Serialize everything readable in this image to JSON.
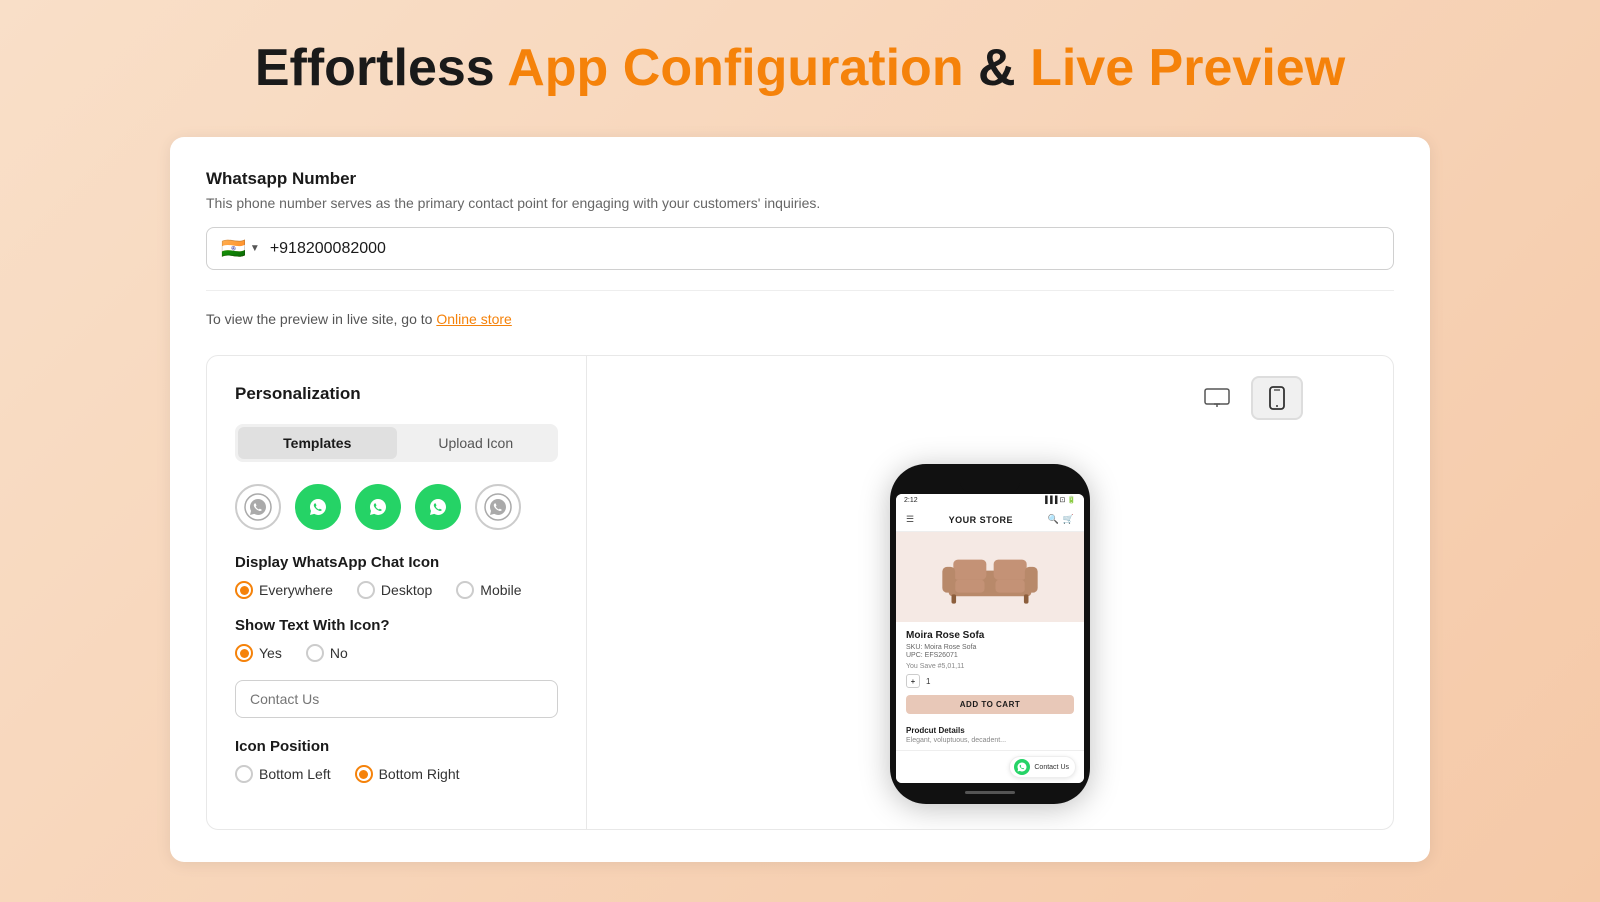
{
  "page": {
    "title_black1": "Effortless",
    "title_accent1": "App Configuration",
    "title_black2": "&",
    "title_accent2": "Live Preview"
  },
  "whatsapp_section": {
    "title": "Whatsapp Number",
    "description": "This phone number serves as the primary contact point for engaging with your customers' inquiries.",
    "flag_emoji": "🇮🇳",
    "phone_value": "+918200082000",
    "preview_note": "To view the preview in live site, go to",
    "preview_link_text": "Online store"
  },
  "personalization": {
    "panel_title": "Personalization",
    "tab_templates": "Templates",
    "tab_upload": "Upload Icon",
    "display_label": "Display WhatsApp Chat Icon",
    "display_options": [
      "Everywhere",
      "Desktop",
      "Mobile"
    ],
    "display_selected": 0,
    "show_text_label": "Show Text With Icon?",
    "show_text_options": [
      "Yes",
      "No"
    ],
    "show_text_selected": 0,
    "contact_us_placeholder": "Contact Us",
    "position_label": "Icon Position",
    "position_options": [
      "Bottom Left",
      "Bottom Right"
    ],
    "position_selected": 1
  },
  "preview": {
    "device_icons": [
      "desktop",
      "mobile"
    ],
    "active_device": 1,
    "store_name": "YOUR STORE",
    "product_name": "Moira Rose Sofa",
    "product_sku": "SKU: Moira Rose Sofa",
    "product_upc": "UPC: EFS26071",
    "product_price": "You Save #5,01,11",
    "qty": "1",
    "add_to_cart_label": "ADD TO CART",
    "product_details_title": "Prodcut Details",
    "product_details_text": "Elegant, voluptuous, decadent...",
    "contact_chip_text": "Contact Us",
    "phone_time": "2:12",
    "phone_signal": "●●●"
  }
}
